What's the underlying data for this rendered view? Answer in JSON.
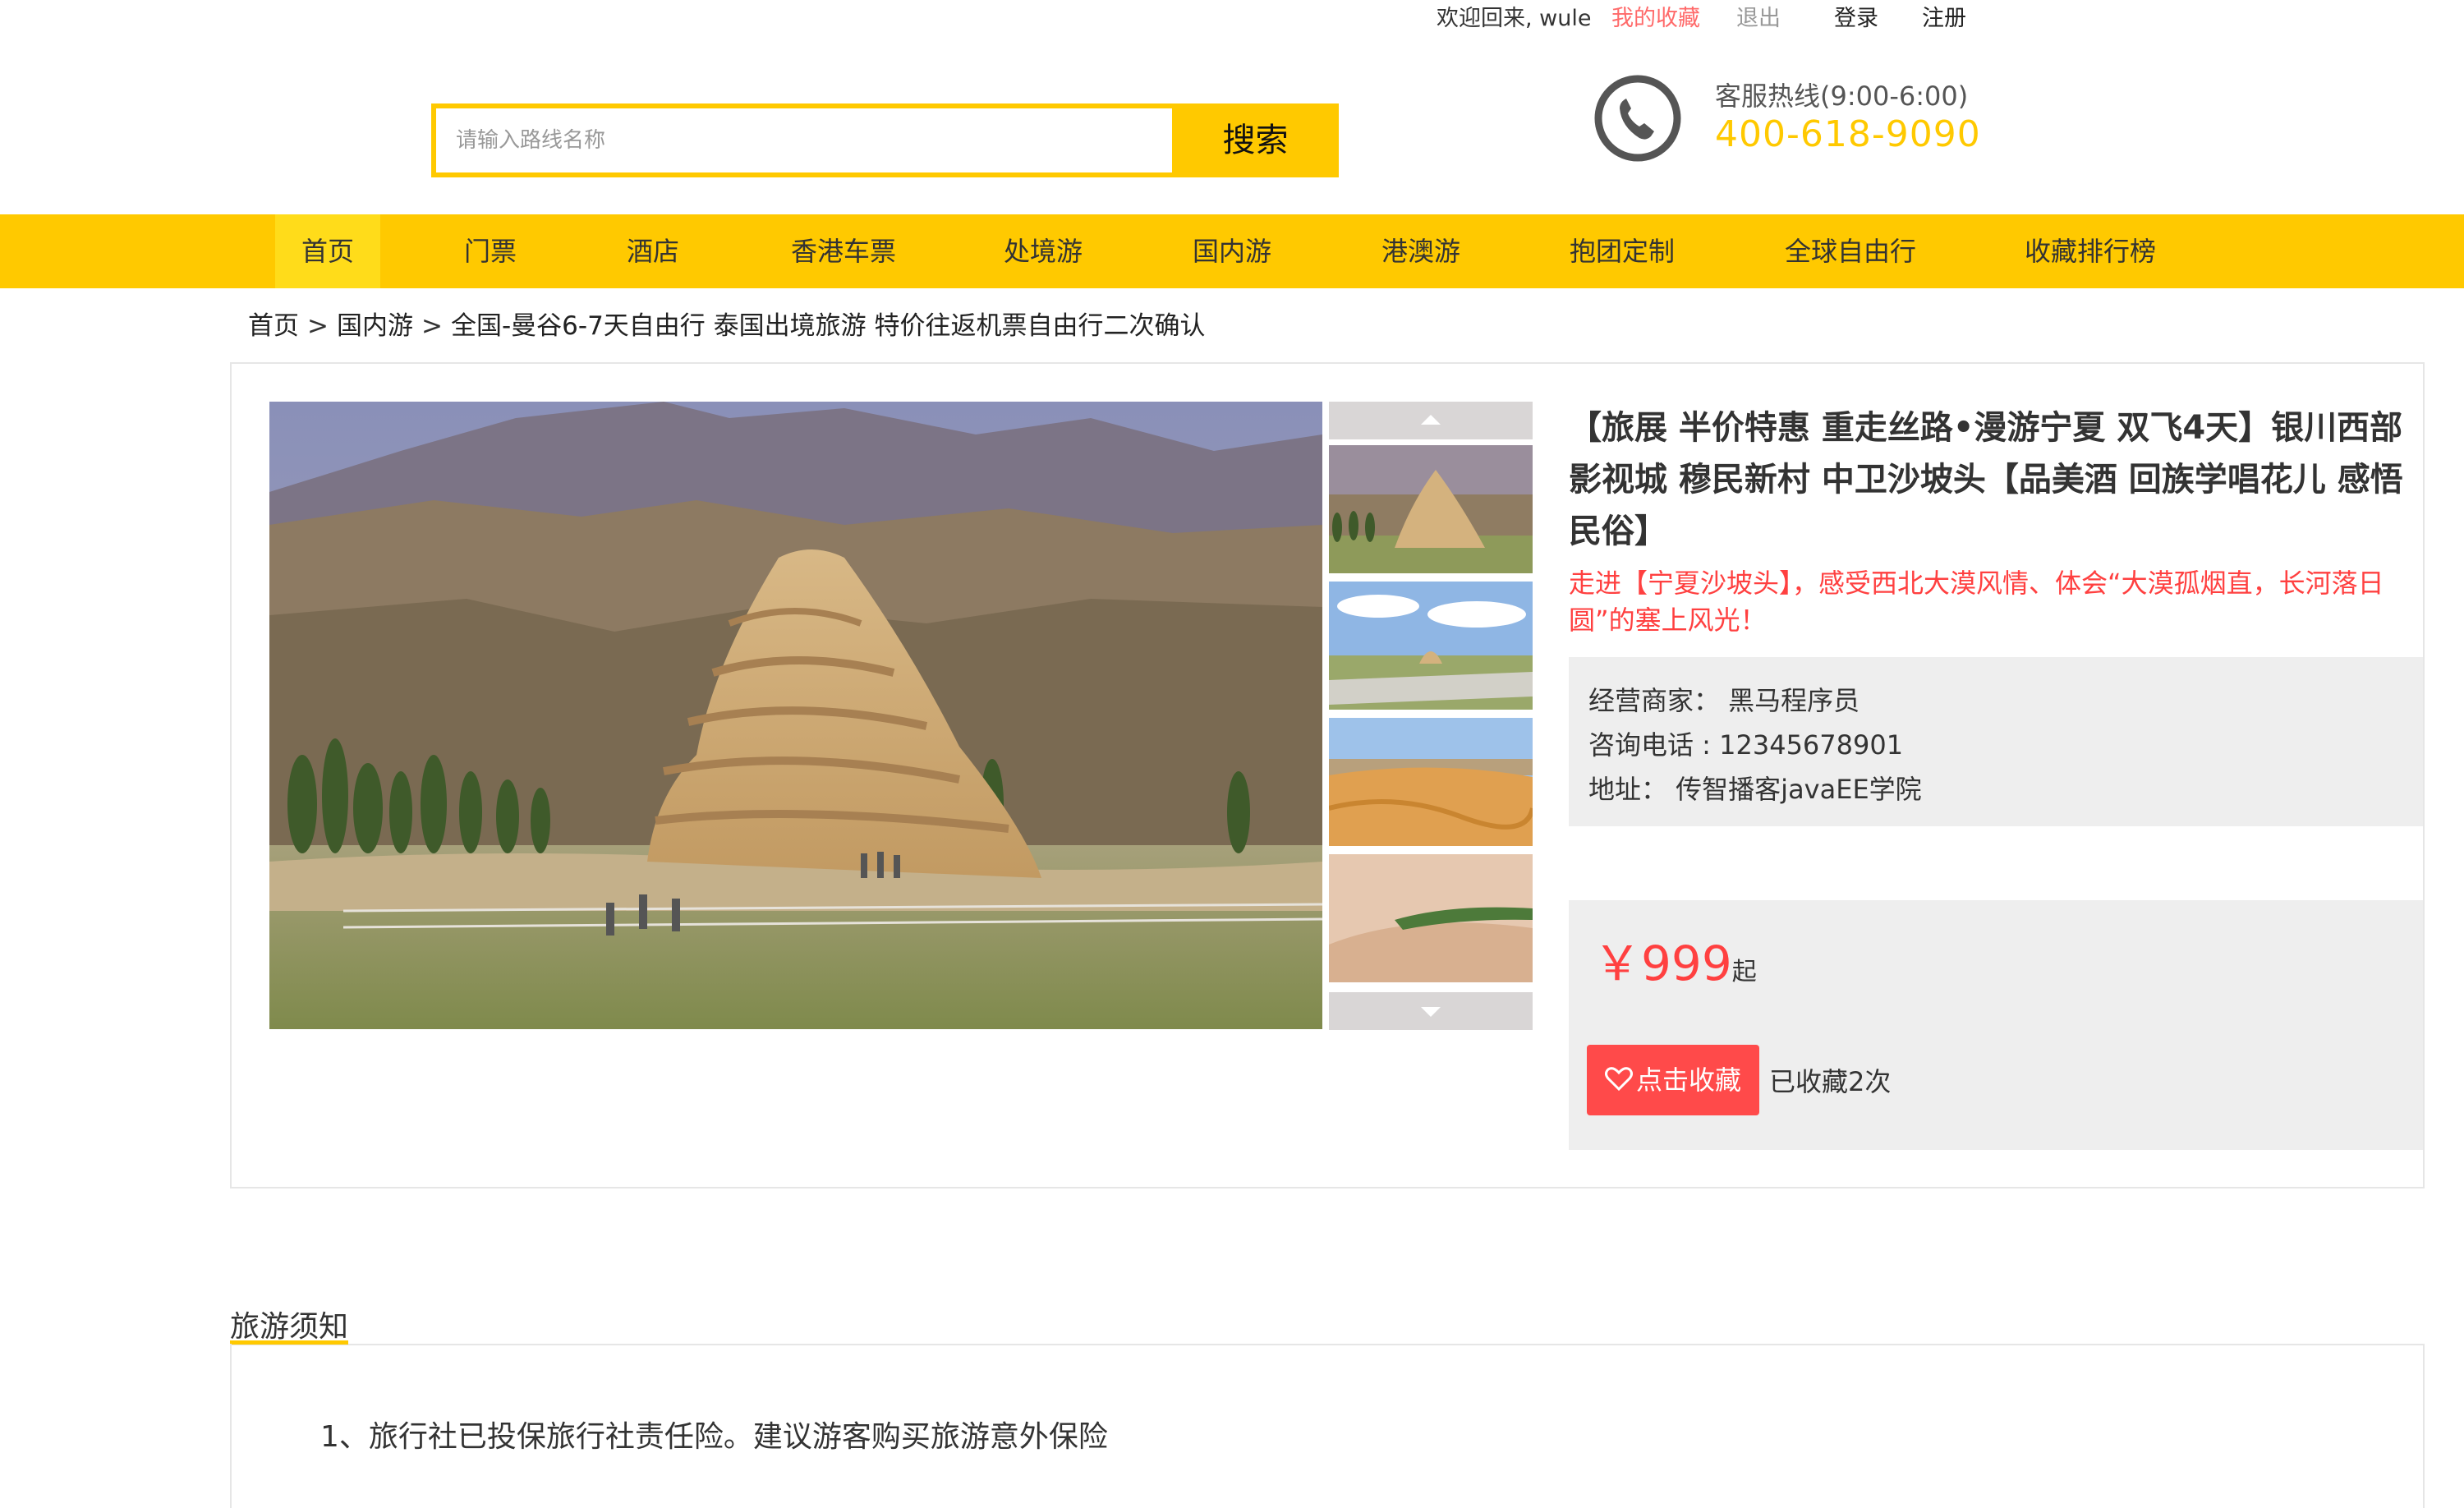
{
  "topbar": {
    "welcome": "欢迎回来, wule",
    "favorites": "我的收藏",
    "logout": "退出",
    "login": "登录",
    "register": "注册"
  },
  "search": {
    "placeholder": "请输入路线名称",
    "value": "",
    "button": "搜索"
  },
  "hotline": {
    "label": "客服热线(9:00-6:00)",
    "number": "400-618-9090"
  },
  "nav": {
    "items": [
      "首页",
      "门票",
      "酒店",
      "香港车票",
      "处境游",
      "国内游",
      "港澳游",
      "抱团定制",
      "全球自由行",
      "收藏排行榜"
    ],
    "active": "首页"
  },
  "breadcrumb": {
    "items": [
      "首页",
      "国内游",
      "全国-曼谷6-7天自由行 泰国出境旅游 特价往返机票自由行二次确认"
    ],
    "separator": ">"
  },
  "product": {
    "title": "【旅展 半价特惠 重走丝路•漫游宁夏 双飞4天】银川西部影视城 穆民新村 中卫沙坡头【品美酒 回族学唱花儿 感悟民俗】",
    "subtitle": "走进【宁夏沙坡头】，感受西北大漠风情、体会“大漠孤烟直，长河落日圆”的塞上风光！",
    "merchant": "经营商家： 黑马程序员",
    "phone": "咨询电话 : 12345678901",
    "address": "地址： 传智播客javaEE学院",
    "price_symbol": "￥",
    "price": "999",
    "price_suffix": "起",
    "collect_button": "点击收藏",
    "collect_count": "已收藏2次"
  },
  "notes": {
    "tab": "旅游须知",
    "items": [
      "1、旅行社已投保旅行社责任险。建议游客购买旅游意外保险"
    ]
  },
  "colors": {
    "brand_yellow": "#ffc900",
    "accent_red": "#ff4040",
    "panel_gray": "#eeeeee"
  }
}
